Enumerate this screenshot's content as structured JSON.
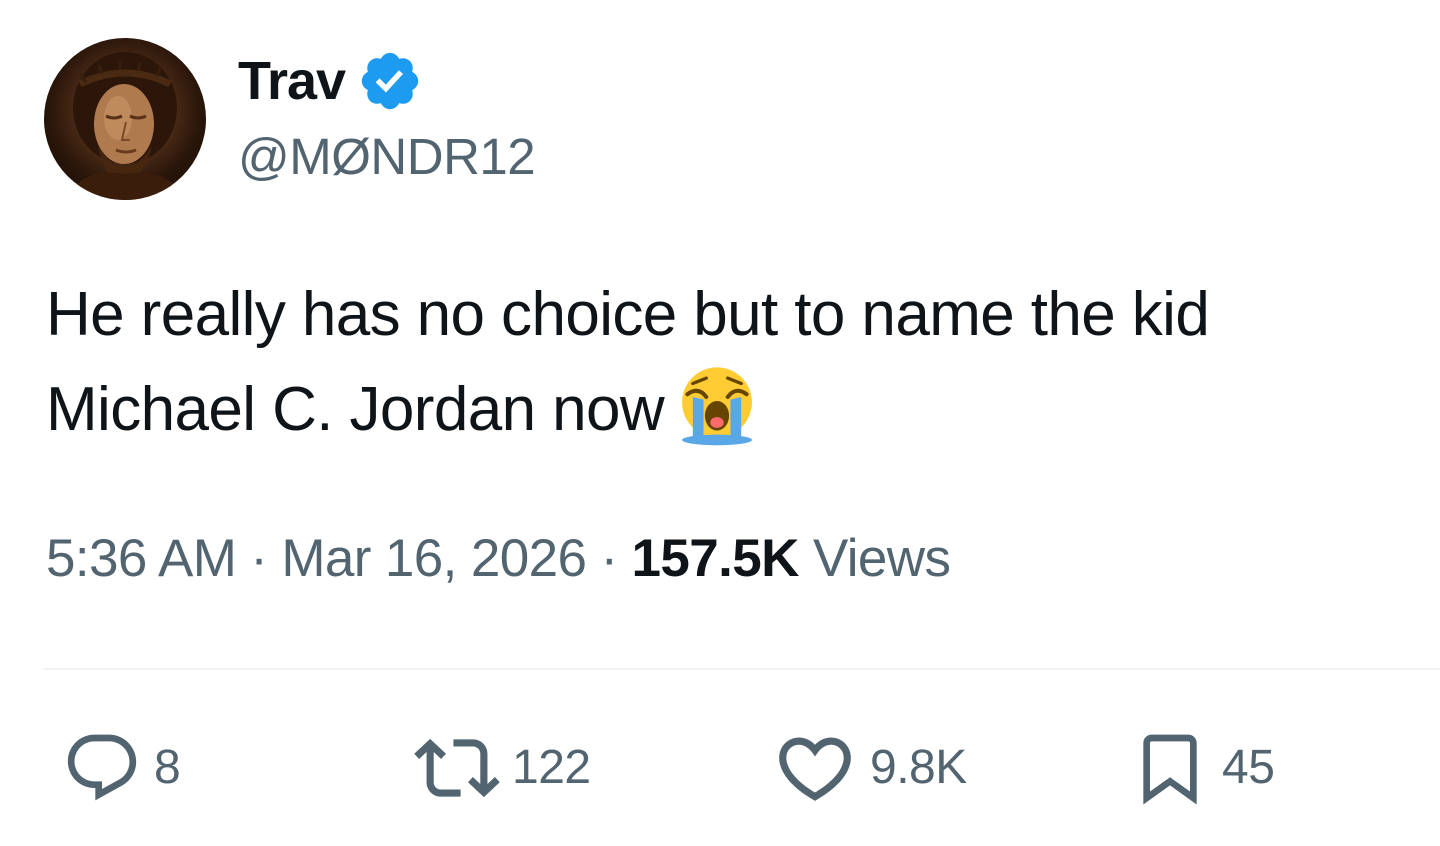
{
  "author": {
    "display_name": "Trav",
    "handle": "@MØNDR12",
    "verified": true,
    "avatar_icon": "portrait-avatar",
    "verified_color": "#1d9bf0"
  },
  "tweet": {
    "text": "He really has no choice but to name the kid Michael C. Jordan now",
    "emoji": "loudly-crying-face-emoji"
  },
  "meta": {
    "time": "5:36 AM",
    "date": "Mar 16, 2026",
    "separator": "·",
    "views_count": "157.5K",
    "views_label": "Views"
  },
  "actions": {
    "reply": {
      "icon": "reply-icon",
      "count": "8"
    },
    "retweet": {
      "icon": "retweet-icon",
      "count": "122"
    },
    "like": {
      "icon": "heart-icon",
      "count": "9.8K"
    },
    "bookmark": {
      "icon": "bookmark-icon",
      "count": "45"
    }
  },
  "colors": {
    "text_primary": "#0f1419",
    "text_secondary": "#536471",
    "divider": "#eff3f4",
    "verified_blue": "#1d9bf0"
  }
}
